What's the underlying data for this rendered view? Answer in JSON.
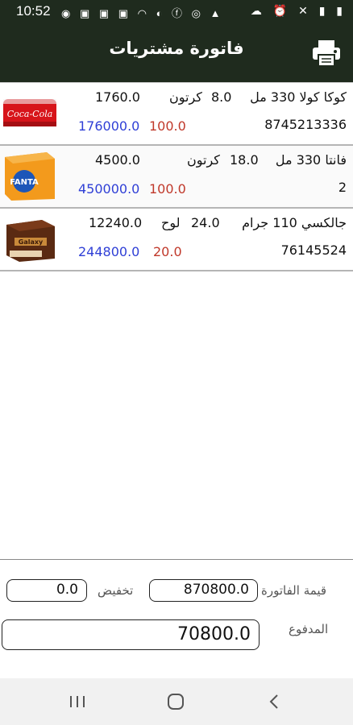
{
  "status_bar": {
    "time": "10:52",
    "left_icons": "◉ ▣ ▣ ▣ ◠ ◐ ⓕ ◎ ▲",
    "right_icons": "☁ ⏰ ✕ ▮ ▮"
  },
  "header": {
    "title": "فاتورة مشتريات",
    "print_icon": "printer-icon"
  },
  "items": [
    {
      "name": "كوكا كولا 330 مل",
      "qty": "8.0",
      "unit": "كرتون",
      "price": "1760.0",
      "code": "8745213336",
      "discount": "100.0",
      "total": "176000.0",
      "image": "coca-cola-pack"
    },
    {
      "name": "فانتا 330 مل",
      "qty": "18.0",
      "unit": "كرتون",
      "price": "4500.0",
      "code": "2",
      "discount": "100.0",
      "total": "450000.0",
      "image": "fanta-box"
    },
    {
      "name": "جالكسي 110 جرام",
      "qty": "24.0",
      "unit": "لوح",
      "price": "12240.0",
      "code": "76145524",
      "discount": "20.0",
      "total": "244800.0",
      "image": "galaxy-box"
    }
  ],
  "summary": {
    "invoice_label": "قيمة الفاتورة",
    "invoice_value": "870800.0",
    "discount_label": "تخفيض",
    "discount_value": "0.0",
    "paid_label": "المدفوع",
    "paid_value": "70800.0"
  },
  "colors": {
    "header_bg": "#1f2b1e",
    "discount": "#c0392b",
    "total": "#2f3fd6"
  }
}
